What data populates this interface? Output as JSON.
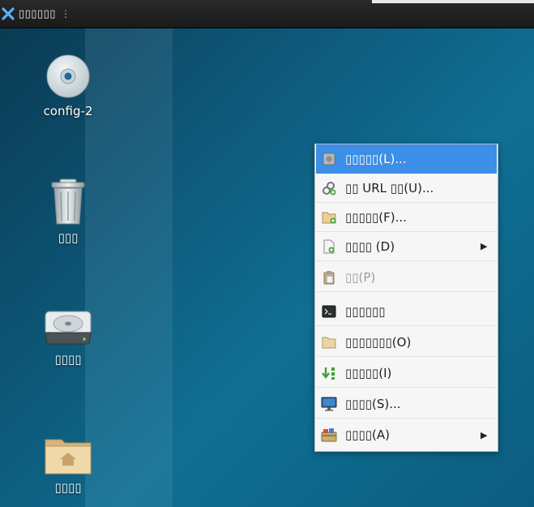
{
  "panel": {
    "title": "▯▯▯▯▯▯",
    "grip": "⋮"
  },
  "desktop": {
    "icons": [
      {
        "label": "config-2",
        "icon": "optical-disc-icon"
      },
      {
        "label": "▯▯▯",
        "icon": "trash-icon"
      },
      {
        "label": "▯▯▯▯",
        "icon": "hard-drive-icon"
      },
      {
        "label": "▯▯▯▯",
        "icon": "home-folder-icon"
      }
    ]
  },
  "menu": {
    "items": [
      {
        "label": "▯▯▯▯▯(L)...",
        "state": "selected",
        "icon": "launcher-icon"
      },
      {
        "label": "▯▯ URL ▯▯(U)...",
        "state": "normal",
        "icon": "link-icon"
      },
      {
        "label": "▯▯▯▯▯(F)...",
        "state": "normal",
        "icon": "new-folder-icon"
      },
      {
        "label": "▯▯▯▯ (D)",
        "state": "normal",
        "icon": "new-document-icon",
        "submenu": true
      },
      {
        "label": "▯▯(P)",
        "state": "disabled",
        "icon": "paste-icon"
      },
      {
        "label": "▯▯▯▯▯▯",
        "state": "normal",
        "icon": "terminal-icon"
      },
      {
        "label": "▯▯▯▯▯▯▯(O)",
        "state": "normal",
        "icon": "folder-icon"
      },
      {
        "label": "▯▯▯▯▯(I)",
        "state": "normal",
        "icon": "arrange-icon"
      },
      {
        "label": "▯▯▯▯(S)...",
        "state": "normal",
        "icon": "desktop-settings-icon"
      },
      {
        "label": "▯▯▯▯(A)",
        "state": "normal",
        "icon": "applications-icon",
        "submenu": true
      }
    ],
    "submenu_arrow": "▶"
  },
  "colors": {
    "selection": "#3d8ee6",
    "panel": "#1f1f1f",
    "desktop": "#0e5a7c"
  }
}
